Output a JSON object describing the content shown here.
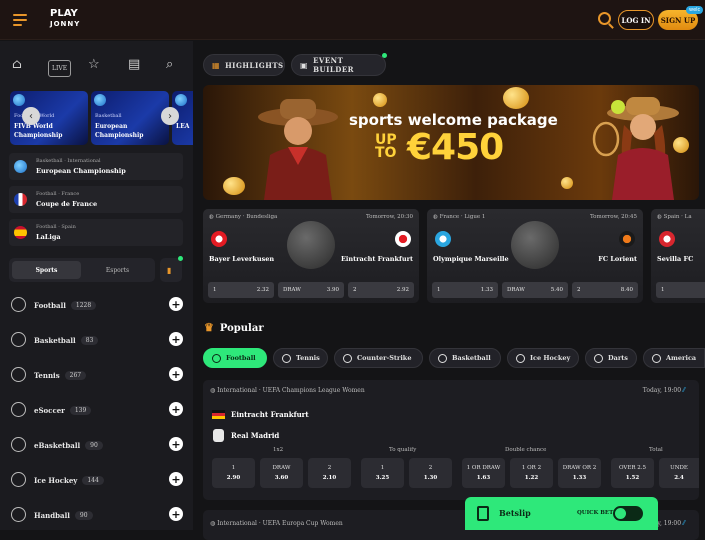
{
  "header": {
    "logo_line1": "PLAY",
    "logo_line2": "JONNY",
    "login": "LOG IN",
    "signup": "SIGN UP",
    "signup_badge": "welc"
  },
  "sidebar": {
    "nav_live": "LIVE",
    "tiles": [
      {
        "category": "Football · World",
        "title": "FIVB World Championship"
      },
      {
        "category": "Basketball",
        "title": "European Championship"
      },
      {
        "category": "",
        "title": "LEA"
      }
    ],
    "competitions": [
      {
        "category": "Basketball · International",
        "title": "European Championship",
        "flag": "globe"
      },
      {
        "category": "Football · France",
        "title": "Coupe de France",
        "flag": "france"
      },
      {
        "category": "Football · Spain",
        "title": "LaLiga",
        "flag": "spain"
      }
    ],
    "tabs": [
      "Sports",
      "Esports"
    ],
    "sports": [
      {
        "name": "Football",
        "count": "1228"
      },
      {
        "name": "Basketball",
        "count": "83"
      },
      {
        "name": "Tennis",
        "count": "267"
      },
      {
        "name": "eSoccer",
        "count": "139"
      },
      {
        "name": "eBasketball",
        "count": "90"
      },
      {
        "name": "Ice Hockey",
        "count": "144"
      },
      {
        "name": "Handball",
        "count": "90"
      }
    ]
  },
  "main": {
    "chips": [
      "HIGHLIGHTS",
      "EVENT BUILDER"
    ],
    "banner": {
      "title": "sports welcome package",
      "up": "UP",
      "to": "TO",
      "amount": "€450"
    },
    "matches": [
      {
        "league": "Germany · Bundesliga",
        "time": "Tomorrow, 20:30",
        "home": "Bayer Leverkusen",
        "away": "Eintracht Frankfurt",
        "odds": [
          [
            "1",
            "2.32"
          ],
          [
            "DRAW",
            "3.90"
          ],
          [
            "2",
            "2.92"
          ]
        ]
      },
      {
        "league": "France · Ligue 1",
        "time": "Tomorrow, 20:45",
        "home": "Olympique Marseille",
        "away": "FC Lorient",
        "odds": [
          [
            "1",
            "1.33"
          ],
          [
            "DRAW",
            "5.40"
          ],
          [
            "2",
            "8.40"
          ]
        ]
      },
      {
        "league": "Spain · La",
        "time": "",
        "home": "Sevilla FC",
        "away": "",
        "odds": [
          [
            "1",
            ""
          ]
        ]
      }
    ],
    "popular": "Popular",
    "sport_tabs": [
      "Football",
      "Tennis",
      "Counter-Strike",
      "Basketball",
      "Ice Hockey",
      "Darts",
      "America"
    ],
    "event": {
      "league": "International · UEFA Champions League Women",
      "time": "Today, 19:00",
      "home": "Eintracht Frankfurt",
      "away": "Real Madrid",
      "markets": [
        "1x2",
        "To qualify",
        "Double chance",
        "Total"
      ],
      "odds": [
        [
          "1",
          "2.90"
        ],
        [
          "DRAW",
          "3.60"
        ],
        [
          "2",
          "2.10"
        ],
        [
          "1",
          "3.25"
        ],
        [
          "2",
          "1.30"
        ],
        [
          "1 OR DRAW",
          "1.63"
        ],
        [
          "1 OR 2",
          "1.22"
        ],
        [
          "DRAW OR 2",
          "1.33"
        ],
        [
          "OVER 2.5",
          "1.52"
        ],
        [
          "UNDE",
          "2.4"
        ]
      ]
    },
    "event2": {
      "league": "International · UEFA Europa Cup Women",
      "time": "Today, 19:00"
    },
    "betslip": {
      "label": "Betslip",
      "quick_bet": "QUICK BET"
    }
  }
}
